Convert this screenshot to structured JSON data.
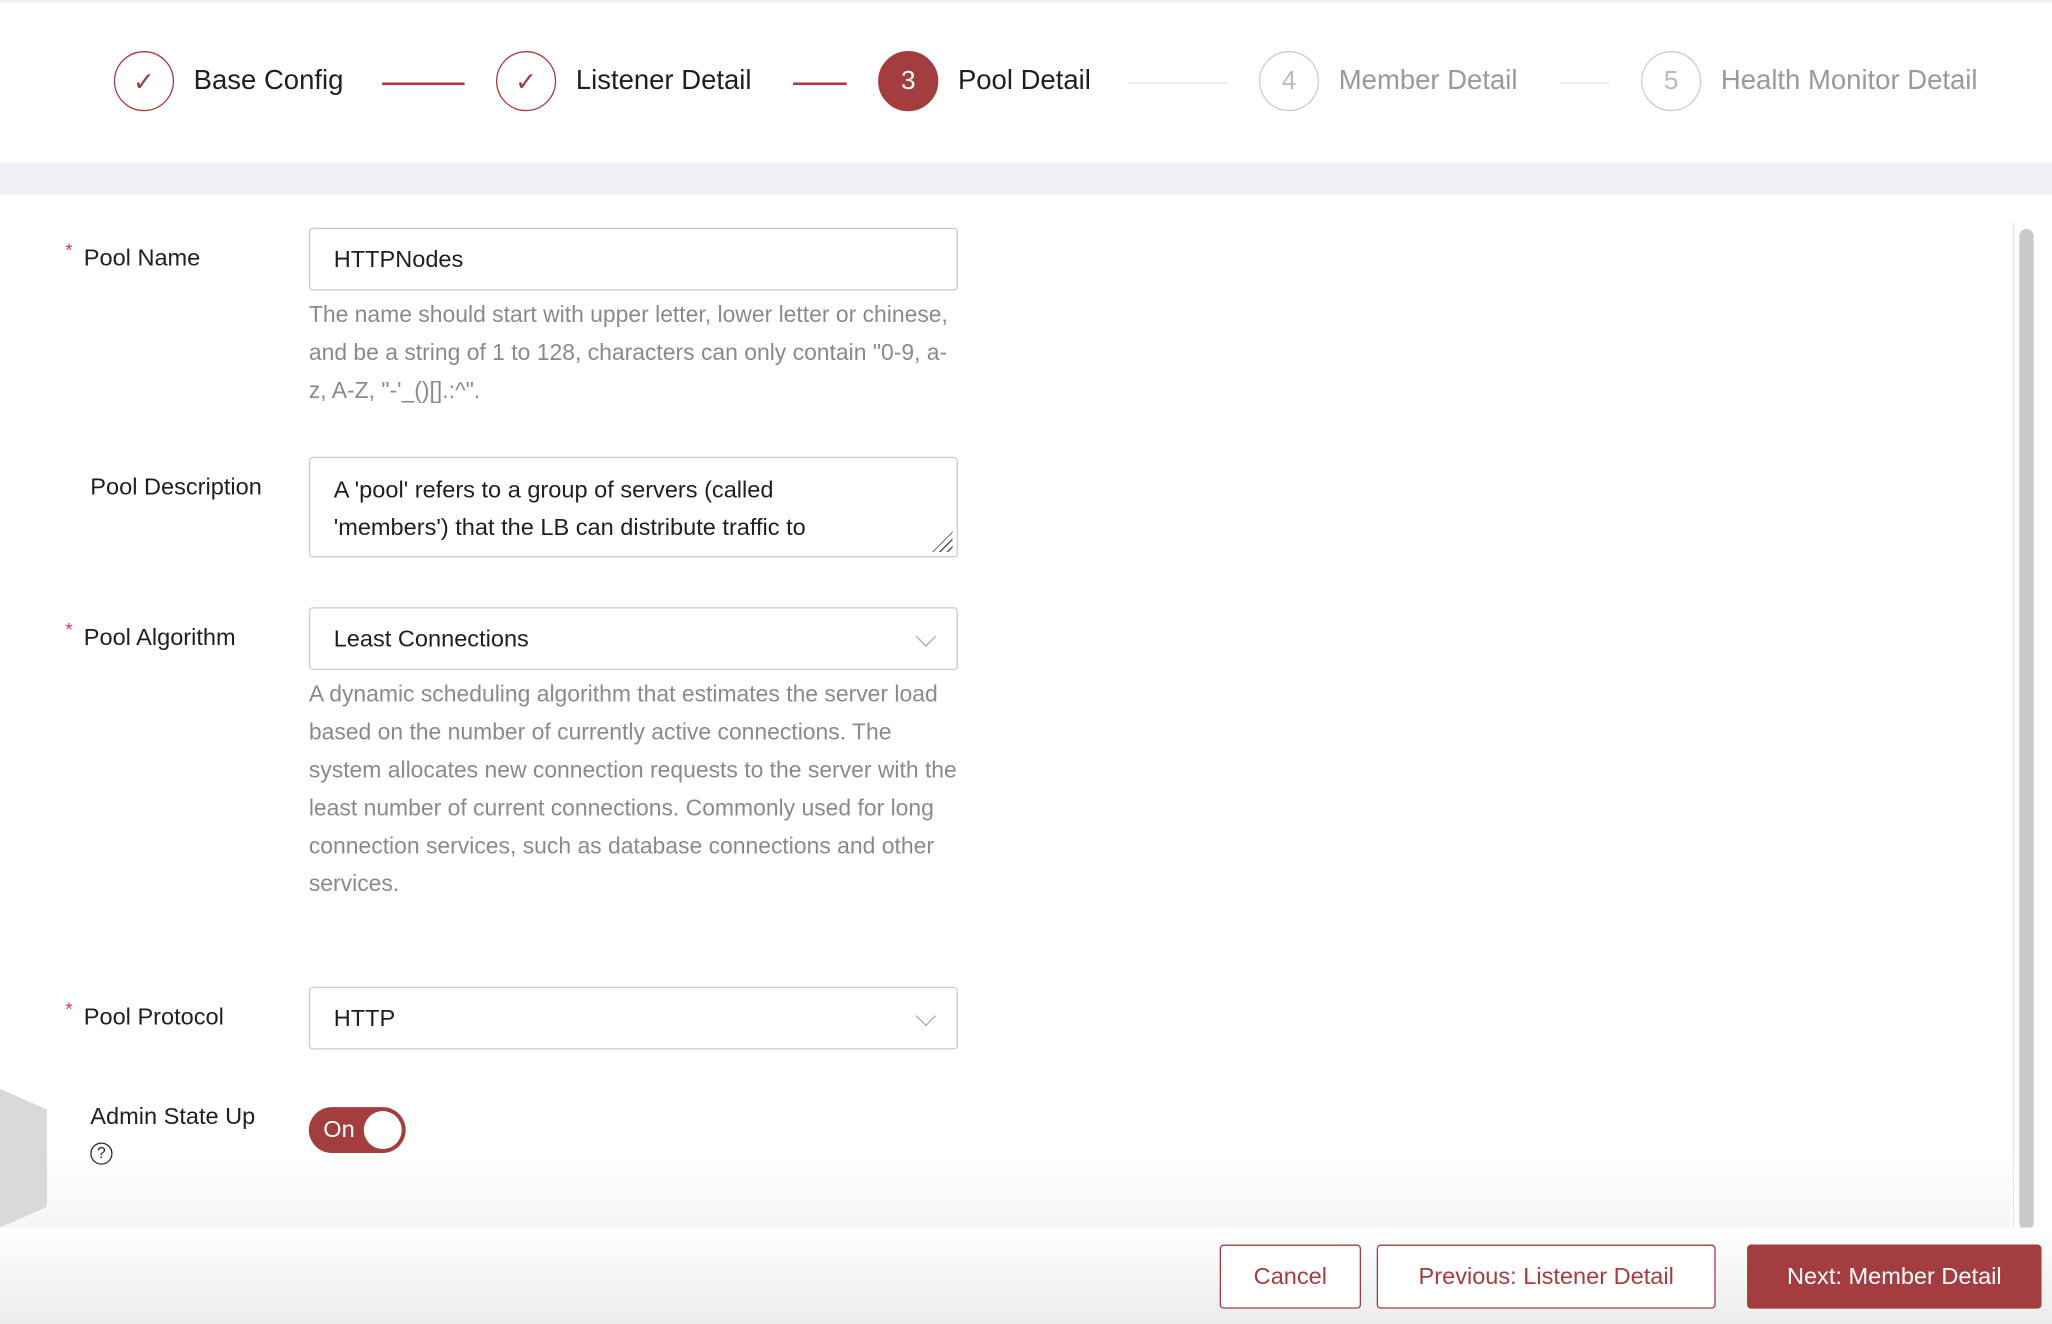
{
  "steps": [
    {
      "number": "1",
      "label": "Base Config",
      "status": "done"
    },
    {
      "number": "2",
      "label": "Listener Detail",
      "status": "done"
    },
    {
      "number": "3",
      "label": "Pool Detail",
      "status": "active"
    },
    {
      "number": "4",
      "label": "Member Detail",
      "status": "pending"
    },
    {
      "number": "5",
      "label": "Health Monitor Detail",
      "status": "pending"
    }
  ],
  "form": {
    "pool_name": {
      "label": "Pool Name",
      "required": true,
      "value": "HTTPNodes",
      "help": "The name should start with upper letter, lower letter or chinese, and be a string of 1 to 128, characters can only contain \"0-9, a-z, A-Z, \"-'_()[].:^\"."
    },
    "pool_description": {
      "label": "Pool Description",
      "value": "A 'pool' refers to a group of servers (called 'members') that the LB can distribute traffic to"
    },
    "pool_algorithm": {
      "label": "Pool Algorithm",
      "required": true,
      "value": "Least Connections",
      "help": "A dynamic scheduling algorithm that estimates the server load based on the number of currently active connections. The system allocates new connection requests to the server with the least number of current connections. Commonly used for long connection services, such as database connections and other services."
    },
    "pool_protocol": {
      "label": "Pool Protocol",
      "required": true,
      "value": "HTTP"
    },
    "admin_state_up": {
      "label": "Admin State Up",
      "value": "On",
      "enabled": true
    }
  },
  "footer": {
    "cancel": "Cancel",
    "previous": "Previous: Listener Detail",
    "next": "Next: Member Detail"
  },
  "colors": {
    "accent": "#a33d3f",
    "required": "#d9363e"
  }
}
